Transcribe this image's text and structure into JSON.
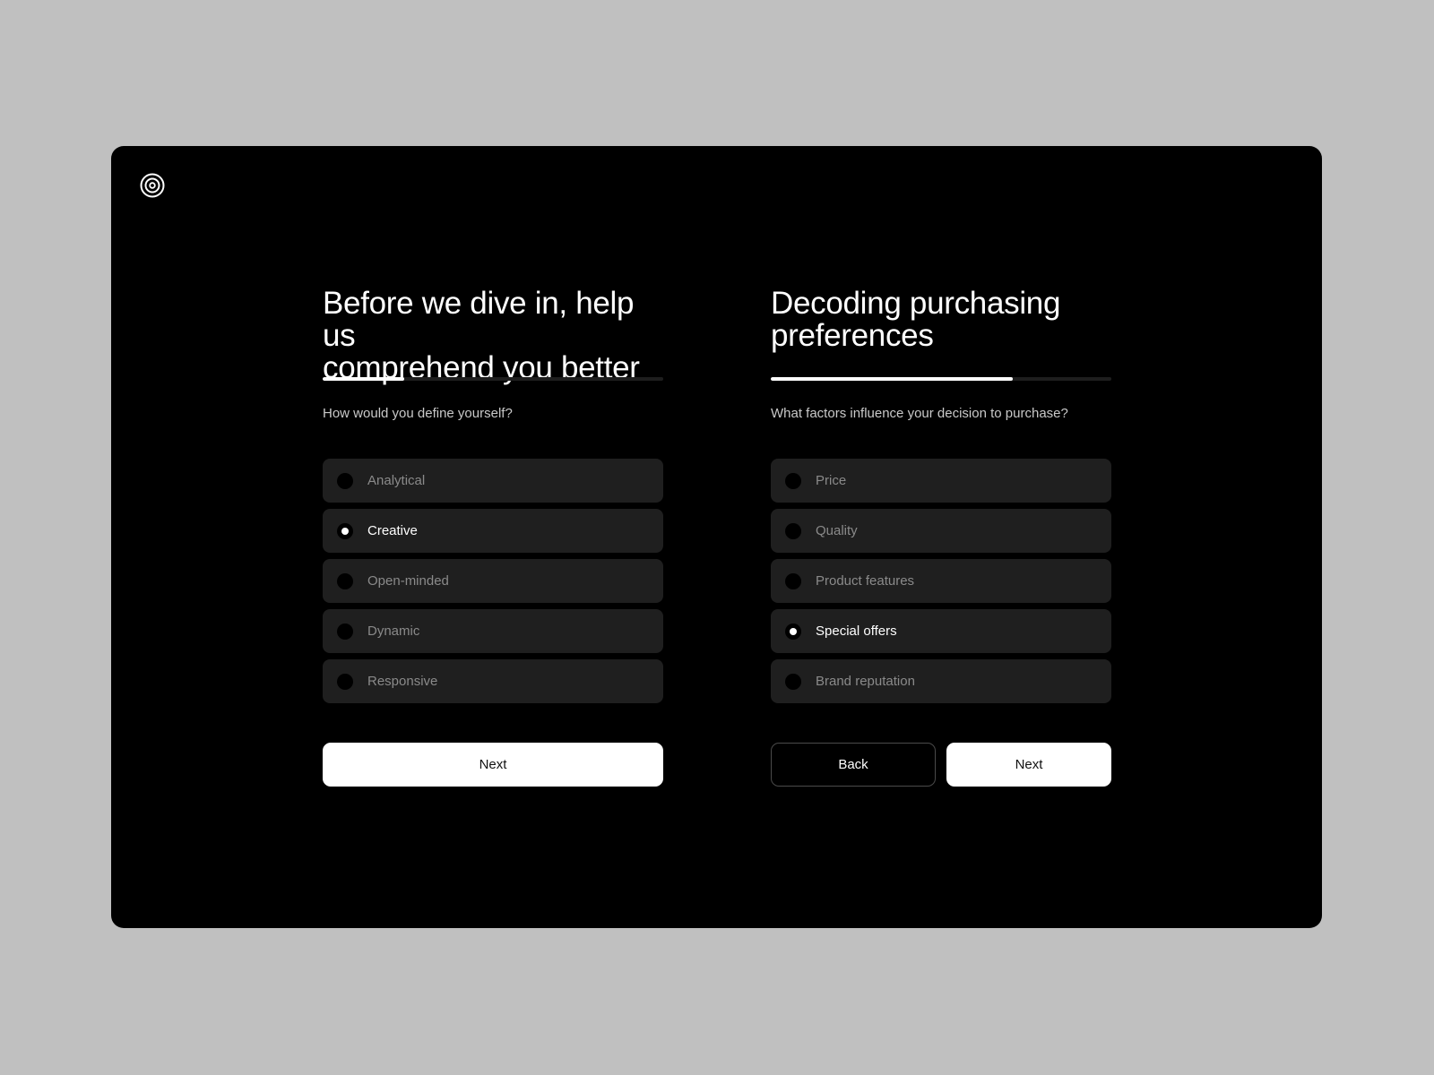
{
  "app": {
    "logo_icon": "target-concentric-circles-icon"
  },
  "colors": {
    "page_background": "#c0c0c0",
    "card_background": "#000000",
    "option_background": "#1f1f1f",
    "progress_track": "#1e1e1e",
    "progress_fill": "#ffffff",
    "selected_text": "#ffffff",
    "unselected_text": "#8a8a8a"
  },
  "panels": [
    {
      "title_line1": "Before we dive in, help us",
      "title_line2": "comprehend you better",
      "progress_percent": 24,
      "question": "How would you define yourself?",
      "options": [
        {
          "label": "Analytical",
          "selected": false
        },
        {
          "label": "Creative",
          "selected": true
        },
        {
          "label": "Open-minded",
          "selected": false
        },
        {
          "label": "Dynamic",
          "selected": false
        },
        {
          "label": "Responsive",
          "selected": false
        }
      ],
      "next_label": "Next"
    },
    {
      "title_line1": "Decoding purchasing",
      "title_line2": "preferences",
      "progress_percent": 71,
      "question": "What factors influence your decision to purchase?",
      "options": [
        {
          "label": "Price",
          "selected": false
        },
        {
          "label": "Quality",
          "selected": false
        },
        {
          "label": "Product features",
          "selected": false
        },
        {
          "label": "Special offers",
          "selected": true
        },
        {
          "label": "Brand reputation",
          "selected": false
        }
      ],
      "back_label": "Back",
      "next_label": "Next"
    }
  ]
}
